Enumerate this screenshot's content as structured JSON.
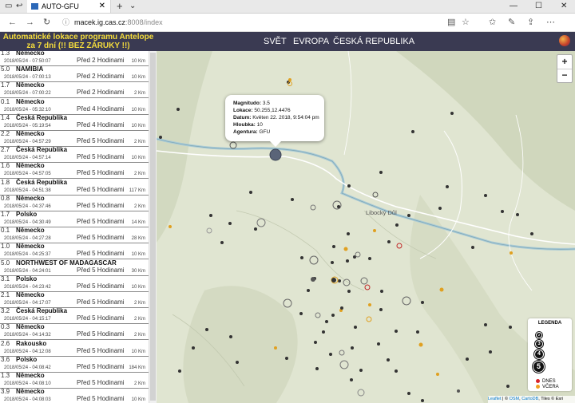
{
  "browser": {
    "tab_title": "AUTO-GFU",
    "url_host": "macek.ig.cas.cz",
    "url_path": ":8008/index"
  },
  "header": {
    "title_line1": "Automatické lokace programu Antelope",
    "title_line2": "za 7 dní (!! BEZ ZÁRUKY !!)",
    "menu": [
      "SVĚT",
      "EVROPA",
      "ČESKÁ REPUBLIKA"
    ]
  },
  "events": [
    {
      "mag": "1.3",
      "name": "Německo",
      "date": "2018/05/24 - 07:50:07",
      "ago": "Před 2 Hodinami",
      "depth": "10 Km"
    },
    {
      "mag": "5.0",
      "name": "NAMIBIA",
      "date": "2018/05/24 - 07:00:13",
      "ago": "Před 2 Hodinami",
      "depth": "10 Km"
    },
    {
      "mag": "1.7",
      "name": "Německo",
      "date": "2018/05/24 - 07:00:22",
      "ago": "Před 2 Hodinami",
      "depth": "2 Km"
    },
    {
      "mag": "0.1",
      "name": "Německo",
      "date": "2018/05/24 - 05:32:10",
      "ago": "Před 4 Hodinami",
      "depth": "10 Km"
    },
    {
      "mag": "1.4",
      "name": "Česká Republika",
      "date": "2018/05/24 - 05:19:54",
      "ago": "Před 4 Hodinami",
      "depth": "10 Km"
    },
    {
      "mag": "2.2",
      "name": "Německo",
      "date": "2018/05/24 - 04:57:29",
      "ago": "Před 5 Hodinami",
      "depth": "2 Km"
    },
    {
      "mag": "2.7",
      "name": "Česká Republika",
      "date": "2018/05/24 - 04:57:14",
      "ago": "Před 5 Hodinami",
      "depth": "10 Km"
    },
    {
      "mag": "1.6",
      "name": "Německo",
      "date": "2018/05/24 - 04:57:05",
      "ago": "Před 5 Hodinami",
      "depth": "2 Km"
    },
    {
      "mag": "1.8",
      "name": "Česká Republika",
      "date": "2018/05/24 - 04:51:38",
      "ago": "Před 5 Hodinami",
      "depth": "117 Km"
    },
    {
      "mag": "0.8",
      "name": "Německo",
      "date": "2018/05/24 - 04:37:46",
      "ago": "Před 5 Hodinami",
      "depth": "2 Km"
    },
    {
      "mag": "1.7",
      "name": "Polsko",
      "date": "2018/05/24 - 04:30:49",
      "ago": "Před 5 Hodinami",
      "depth": "14 Km"
    },
    {
      "mag": "0.1",
      "name": "Německo",
      "date": "2018/05/24 - 04:27:28",
      "ago": "Před 5 Hodinami",
      "depth": "28 Km"
    },
    {
      "mag": "1.0",
      "name": "Německo",
      "date": "2018/05/24 - 04:25:37",
      "ago": "Před 5 Hodinami",
      "depth": "10 Km"
    },
    {
      "mag": "5.0",
      "name": "NORTHWEST OF MADAGASCAR",
      "date": "2018/05/24 - 04:24:01",
      "ago": "Před 5 Hodinami",
      "depth": "30 Km"
    },
    {
      "mag": "3.1",
      "name": "Polsko",
      "date": "2018/05/24 - 04:23:42",
      "ago": "Před 5 Hodinami",
      "depth": "10 Km"
    },
    {
      "mag": "2.1",
      "name": "Německo",
      "date": "2018/05/24 - 04:17:07",
      "ago": "Před 5 Hodinami",
      "depth": "2 Km"
    },
    {
      "mag": "3.2",
      "name": "Česká Republika",
      "date": "2018/05/24 - 04:15:17",
      "ago": "Před 5 Hodinami",
      "depth": "2 Km"
    },
    {
      "mag": "0.3",
      "name": "Německo",
      "date": "2018/05/24 - 04:14:32",
      "ago": "Před 5 Hodinami",
      "depth": "2 Km"
    },
    {
      "mag": "2.6",
      "name": "Rakousko",
      "date": "2018/05/24 - 04:12:08",
      "ago": "Před 5 Hodinami",
      "depth": "10 Km"
    },
    {
      "mag": "3.6",
      "name": "Polsko",
      "date": "2018/05/24 - 04:08:42",
      "ago": "Před 5 Hodinami",
      "depth": "184 Km"
    },
    {
      "mag": "1.3",
      "name": "Německo",
      "date": "2018/05/24 - 04:08:10",
      "ago": "Před 5 Hodinami",
      "depth": "2 Km"
    },
    {
      "mag": "3.9",
      "name": "Německo",
      "date": "2018/05/24 - 04:08:03",
      "ago": "Před 5 Hodinami",
      "depth": "10 Km"
    }
  ],
  "popup": {
    "label_mag": "Magnitudo:",
    "mag": "3.5",
    "label_loc": "Lokace:",
    "loc": "50.255,12.4476",
    "label_date": "Datum:",
    "date": "Květen 22. 2018, 9:54:04 pm",
    "label_depth": "Hloubka:",
    "depth": "10",
    "label_agency": "Agentura:",
    "agency": "GFU"
  },
  "map": {
    "place_label": "Libocký Důl",
    "zoom_in": "+",
    "zoom_out": "−"
  },
  "legend": {
    "title": "LEGENDA",
    "sizes": [
      "2",
      "3",
      "4",
      "5"
    ],
    "today": "DNES",
    "yesterday": "VČERA",
    "today_color": "#d8242a",
    "yesterday_color": "#f0a020"
  },
  "attribution": {
    "leaflet": "Leaflet",
    "osm": "OSM",
    "carto": "CartoDB",
    "rest": ", Tiles © Esri",
    "prefix": " | © "
  }
}
